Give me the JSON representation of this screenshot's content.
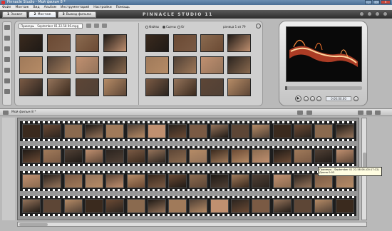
{
  "window": {
    "title": "Pinnacle Studio - Мой фильм 8 *"
  },
  "menu": [
    "Файл",
    "Монтаж",
    "Вид",
    "Альбом",
    "Инструментарий",
    "Настройки",
    "Помощь"
  ],
  "tabs": [
    {
      "num": "1",
      "label": "Захват",
      "active": false
    },
    {
      "num": "2",
      "label": "Монтаж",
      "active": true
    },
    {
      "num": "3",
      "label": "Вывод фильма",
      "active": false
    }
  ],
  "brand": "PINNACLE STUDIO 11",
  "album": {
    "select_value": "Примеры - September 01 22.58 06.mpg",
    "radio_files": "Файлы",
    "radio_scenes": "Сцены",
    "radio_other": "Gr",
    "page_info": "раница 1 из 79"
  },
  "player": {
    "timecode": "0:00:00.00"
  },
  "timeline": {
    "title": "Мой фильм 8 *"
  },
  "tooltip": {
    "line1": "Примеры - September 01 22.58 06 (00:17:12)",
    "line2": "Длина 0:03"
  },
  "colors": {
    "accent": "#4b6f95",
    "background": "#b9b9b9"
  }
}
